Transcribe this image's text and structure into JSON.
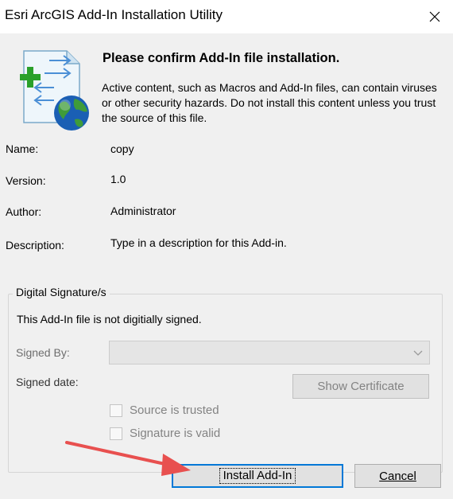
{
  "window": {
    "title": "Esri ArcGIS Add-In Installation Utility",
    "close_icon": "close-icon"
  },
  "header": {
    "heading": "Please confirm Add-In file installation.",
    "description": "Active content, such as Macros and Add-In files, can contain viruses or other security hazards.  Do not install this content unless you trust the source of this file."
  },
  "fields": {
    "name_label": "Name:",
    "name_value": "copy",
    "version_label": "Version:",
    "version_value": "1.0",
    "author_label": "Author:",
    "author_value": "Administrator",
    "description_label": "Description:",
    "description_value": "Type in a description for this Add-in."
  },
  "signature": {
    "legend": "Digital Signature/s",
    "status": "This Add-In file is not digitially signed.",
    "signed_by_label": "Signed By:",
    "signed_by_value": "",
    "signed_date_label": "Signed date:",
    "show_certificate": "Show Certificate",
    "source_trusted": "Source is trusted",
    "signature_valid": "Signature is valid"
  },
  "buttons": {
    "install": "Install Add-In",
    "cancel": "Cancel"
  },
  "colors": {
    "accent": "#0078d7",
    "annotation_arrow": "#e8504f"
  }
}
